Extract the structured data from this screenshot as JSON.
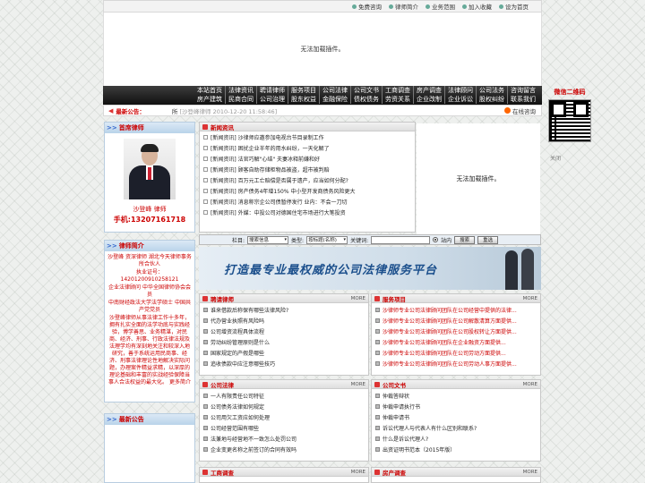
{
  "top_links": [
    "免费咨询",
    "律师简介",
    "业务范围",
    "加入收藏",
    "设为首页"
  ],
  "banner_text": "无法加载插件。",
  "nav": {
    "row1": [
      "本站首页",
      "法律资讯",
      "聘请律师",
      "服务项目",
      "公司法律",
      "公司文书",
      "工商调查",
      "房产调查",
      "法律顾问",
      "公司法务",
      "咨询留言"
    ],
    "row2": [
      "房产建筑",
      "民商合同",
      "公司治理",
      "股东权益",
      "金融保险",
      "债权债务",
      "劳资关系",
      "企业改制",
      "企业诉讼",
      "股权纠纷",
      "联系我们"
    ]
  },
  "notice": {
    "label": "最新公告：",
    "title": "所",
    "author": "沙登峰律师",
    "date": "2010-12-20 11:58:46",
    "online": "在线咨询"
  },
  "left": {
    "lawyer_title": "首席律师",
    "lawyer_name": "沙登峰 律师",
    "lawyer_phone": "手机:13207161718",
    "intro_title": "律师简介",
    "intro_lines": [
      "沙登峰 资深律师 湖北今天律师事务所合伙人",
      "执业证号： 14201200910258121",
      "企业法律顾问 中华全国律师协会会员",
      "中南财经政法大学法学硕士 中国共产党党员",
      "沙登峰律师从事法律工作十多年，拥有扎实全面的法学功底与实践经验，博学善思、业务精湛，对民商、经济、刑事、行政法律法规及法理学均有深刻地关注和较深入地研究，善于系统运用民商事、经济、刑事法律理论性地解决实际问题，办理案件精益求精，以深厚的理论基础和丰富的实战经验保障当事人合法权益的最大化。 更多简介"
    ],
    "news_title": "最新公告"
  },
  "news": {
    "title": "新闻资讯",
    "items": [
      "[新闻资讯] 沙律师应邀参加电视台节目录制工作",
      "[新闻资讯] 困扰企业半年的用水纠纷，一天化解了",
      "[新闻资讯] 法官巧解\"心结\" 夫妻冰释前嫌和好",
      "[新闻资讯] 顾客自助存储柜物品被盗，超市被判赔",
      "[新闻资讯] 百万元工亡赔偿是否属于遗产，应当如何分配?",
      "[新闻资讯] 房产债务4年增150% 中小型开发商债务风险更大",
      "[新闻资讯] 消息称宗企公司债暂停发行 业内：不会一刀切",
      "[新闻资讯] 外媒：中投公司对德国住宅市场进行大笔投资"
    ],
    "plugin_text": "无法加载插件。"
  },
  "search": {
    "label_col": "栏目:",
    "col_value": "搜索信息",
    "label_type": "类型:",
    "type_value": "按标题(名称)",
    "label_kw": "关键词:",
    "site_label": "站内",
    "search_btn": "搜索",
    "reset_btn": "重选"
  },
  "slogan": "打造最专业最权威的公司法律服务平台",
  "boxes": {
    "hire": {
      "title": "聘请律师",
      "more": "MORE",
      "items": [
        "谁来借款后称保有哪些法律风险?",
        "代办营业执照有风险吗",
        "公司增资流程具体流程",
        "劳动纠纷管理原则是什么",
        "国家规定的产假是哪些",
        "追收债款中应注意哪些技巧"
      ]
    },
    "service": {
      "title": "服务项目",
      "more": "MORE",
      "items": [
        "沙律师专业公司法律顾问团队在公司经营中提供的法律...",
        "沙律师专业公司法律顾问团队在公司解散清算方面提供...",
        "沙律师专业公司法律顾问团队在公司股权转让方面提供...",
        "沙律师专业公司法律顾问团队在企业融资方面提供...",
        "沙律师专业公司法律顾问团队在公司劳动方面提供...",
        "沙律师专业公司法律顾问团队在公司劳动人事方面提供..."
      ]
    },
    "company_law": {
      "title": "公司法律",
      "more": "MORE",
      "items": [
        "一人有限责任公司特征",
        "公司债务法律如何规定",
        "公司用欠工资应如何处理",
        "公司经营范围有哪些",
        "法兼地与经营地不一致怎么处罚公司",
        "企业变更名称之前签订的合同有效吗"
      ]
    },
    "company_docs": {
      "title": "公司文书",
      "more": "MORE",
      "items": [
        "仲裁答辩状",
        "仲裁申请执行书",
        "仲裁申请书",
        "诉讼代理人与代表人有什么区别和联系?",
        "什么是诉讼代理人?",
        "出资证明书范本（2015年版）"
      ]
    },
    "business_survey": {
      "title": "工商调查",
      "more": "MORE"
    },
    "property_survey": {
      "title": "房产调查",
      "more": "MORE"
    }
  },
  "ad": {
    "title": "微信二维码",
    "close": "关闭"
  }
}
